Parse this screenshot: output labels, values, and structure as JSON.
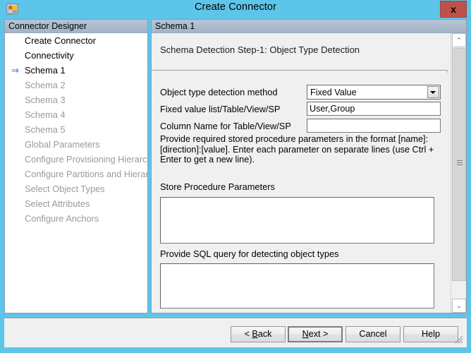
{
  "window": {
    "title": "Create Connector",
    "app_icon": "connector-app-icon",
    "close_label": "x"
  },
  "left_panel": {
    "header": "Connector Designer",
    "items": [
      {
        "label": "Create Connector",
        "state": "enabled",
        "current": false
      },
      {
        "label": "Connectivity",
        "state": "enabled",
        "current": false
      },
      {
        "label": "Schema 1",
        "state": "enabled",
        "current": true
      },
      {
        "label": "Schema 2",
        "state": "disabled",
        "current": false
      },
      {
        "label": "Schema 3",
        "state": "disabled",
        "current": false
      },
      {
        "label": "Schema 4",
        "state": "disabled",
        "current": false
      },
      {
        "label": "Schema 5",
        "state": "disabled",
        "current": false
      },
      {
        "label": "Global Parameters",
        "state": "disabled",
        "current": false
      },
      {
        "label": "Configure Provisioning Hierarchy",
        "state": "disabled",
        "current": false
      },
      {
        "label": "Configure Partitions and Hierarchies",
        "state": "disabled",
        "current": false
      },
      {
        "label": "Select Object Types",
        "state": "disabled",
        "current": false
      },
      {
        "label": "Select Attributes",
        "state": "disabled",
        "current": false
      },
      {
        "label": "Configure Anchors",
        "state": "disabled",
        "current": false
      }
    ],
    "current_arrow_glyph": "⇒"
  },
  "right_panel": {
    "header": "Schema 1",
    "step_title": "Schema Detection Step-1: Object Type Detection",
    "fields": {
      "detection_method": {
        "label": "Object type detection method",
        "value": "Fixed Value",
        "options": [
          "Fixed Value"
        ]
      },
      "fixed_value_list": {
        "label": "Fixed value list/Table/View/SP",
        "value": "User,Group",
        "placeholder": ""
      },
      "column_name": {
        "label": "Column Name for Table/View/SP",
        "value": "",
        "placeholder": ""
      }
    },
    "hint_paragraph": "Provide required stored procedure parameters in the format [name]:[direction]:[value]. Enter each parameter on separate lines (use Ctrl + Enter to get a new line).",
    "store_procedure": {
      "label": "Store Procedure Parameters",
      "value": "",
      "placeholder": ""
    },
    "sql_query": {
      "label": "Provide SQL query for detecting object types",
      "value": "",
      "placeholder": ""
    },
    "scrollbar": {
      "up_glyph": "⌃",
      "down_glyph": "⌄"
    }
  },
  "footer": {
    "buttons": [
      {
        "id": "back",
        "prefix": "< ",
        "mnemonic": "B",
        "rest": "ack",
        "suffix": "",
        "default": false
      },
      {
        "id": "next",
        "prefix": "",
        "mnemonic": "N",
        "rest": "ext",
        "suffix": " >",
        "default": true
      },
      {
        "id": "cancel",
        "prefix": "",
        "mnemonic": "",
        "rest": "Cancel",
        "suffix": "",
        "default": false
      },
      {
        "id": "help",
        "prefix": "",
        "mnemonic": "",
        "rest": "Help",
        "suffix": "",
        "default": false
      }
    ]
  },
  "colors": {
    "titlebar": "#5dc5ea",
    "close_button": "#c0504a",
    "panel_header": "#adbccf",
    "content_bg": "#f0f0f0",
    "current_arrow": "#1f6fd0",
    "disabled_text": "#9a9a9a"
  }
}
